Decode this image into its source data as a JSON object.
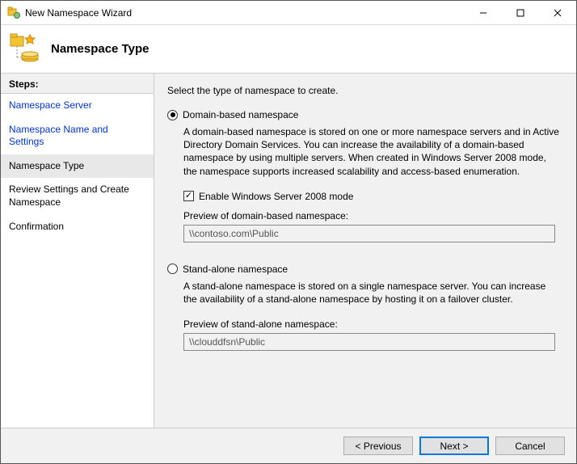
{
  "window": {
    "title": "New Namespace Wizard"
  },
  "banner": {
    "title": "Namespace Type"
  },
  "sidebar": {
    "header": "Steps:",
    "items": [
      {
        "label": "Namespace Server",
        "state": "link"
      },
      {
        "label": "Namespace Name and Settings",
        "state": "link"
      },
      {
        "label": "Namespace Type",
        "state": "current"
      },
      {
        "label": "Review Settings and Create Namespace",
        "state": "future"
      },
      {
        "label": "Confirmation",
        "state": "future"
      }
    ]
  },
  "content": {
    "instruction": "Select the type of namespace to create.",
    "option1": {
      "label": "Domain-based namespace",
      "checked": true,
      "description": "A domain-based namespace is stored on one or more namespace servers and in Active Directory Domain Services. You can increase the availability of a domain-based namespace by using multiple servers. When created in Windows Server 2008 mode, the namespace supports increased scalability and access-based enumeration.",
      "checkbox_label": "Enable Windows Server 2008 mode",
      "checkbox_checked": true,
      "preview_label": "Preview of domain-based namespace:",
      "preview_value": "\\\\contoso.com\\Public"
    },
    "option2": {
      "label": "Stand-alone namespace",
      "checked": false,
      "description": "A stand-alone namespace is stored on a single namespace server. You can increase the availability of a stand-alone namespace by hosting it on a failover cluster.",
      "preview_label": "Preview of stand-alone namespace:",
      "preview_value": "\\\\clouddfsn\\Public"
    }
  },
  "footer": {
    "previous": "< Previous",
    "next": "Next >",
    "cancel": "Cancel"
  }
}
